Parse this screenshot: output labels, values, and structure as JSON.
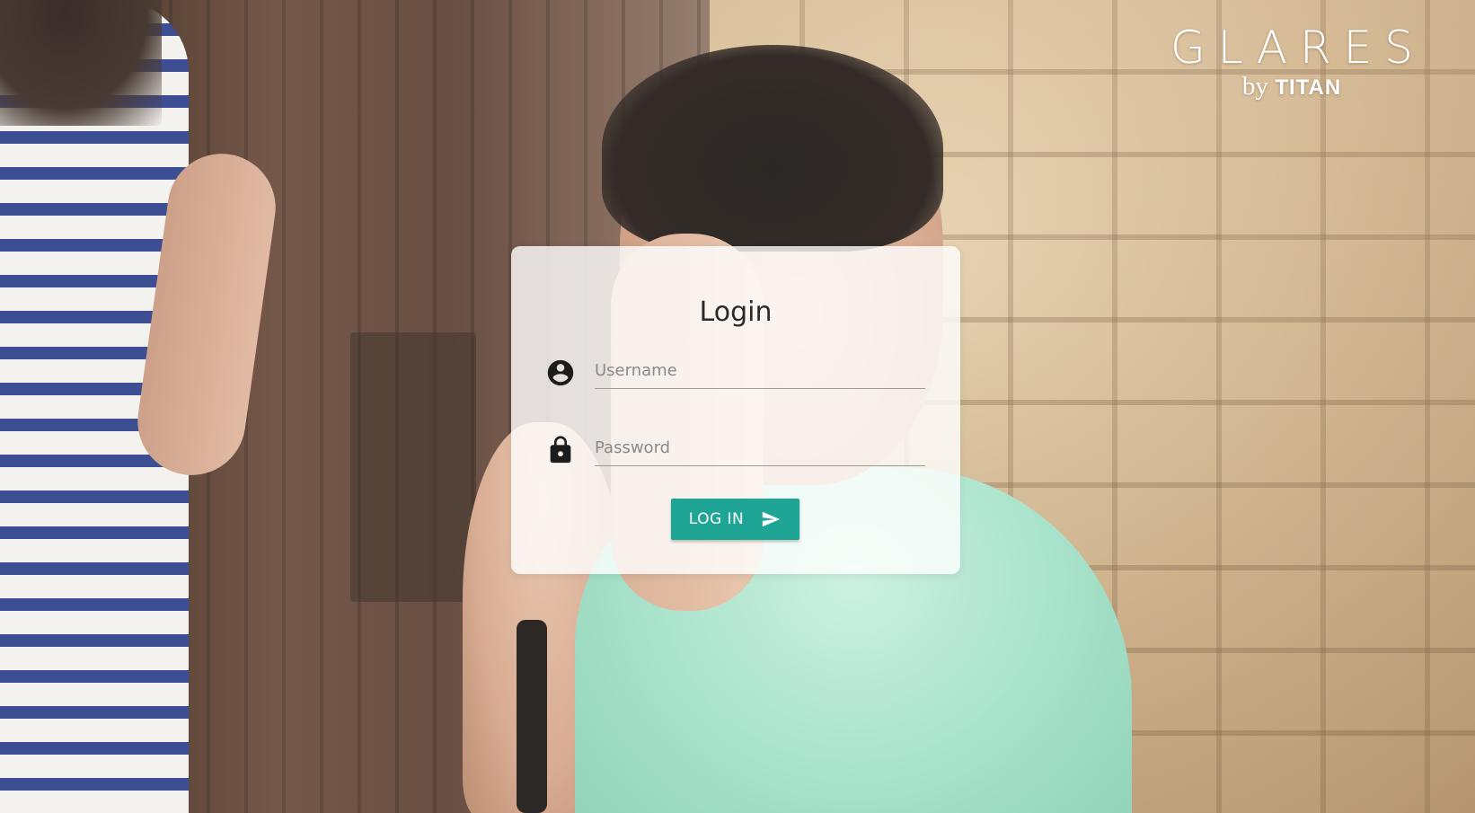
{
  "brand": {
    "logo_main": "GLARES",
    "logo_by": "by",
    "logo_brand": "TITAN"
  },
  "login": {
    "title": "Login",
    "username_placeholder": "Username",
    "password_placeholder": "Password",
    "submit_label": "LOG IN",
    "username_icon": "account-circle-icon",
    "password_icon": "lock-icon",
    "submit_icon": "send-icon"
  },
  "colors": {
    "accent": "#1fa595",
    "card_background": "rgba(255,255,255,0.80)",
    "title_text": "#2a2a2a"
  }
}
